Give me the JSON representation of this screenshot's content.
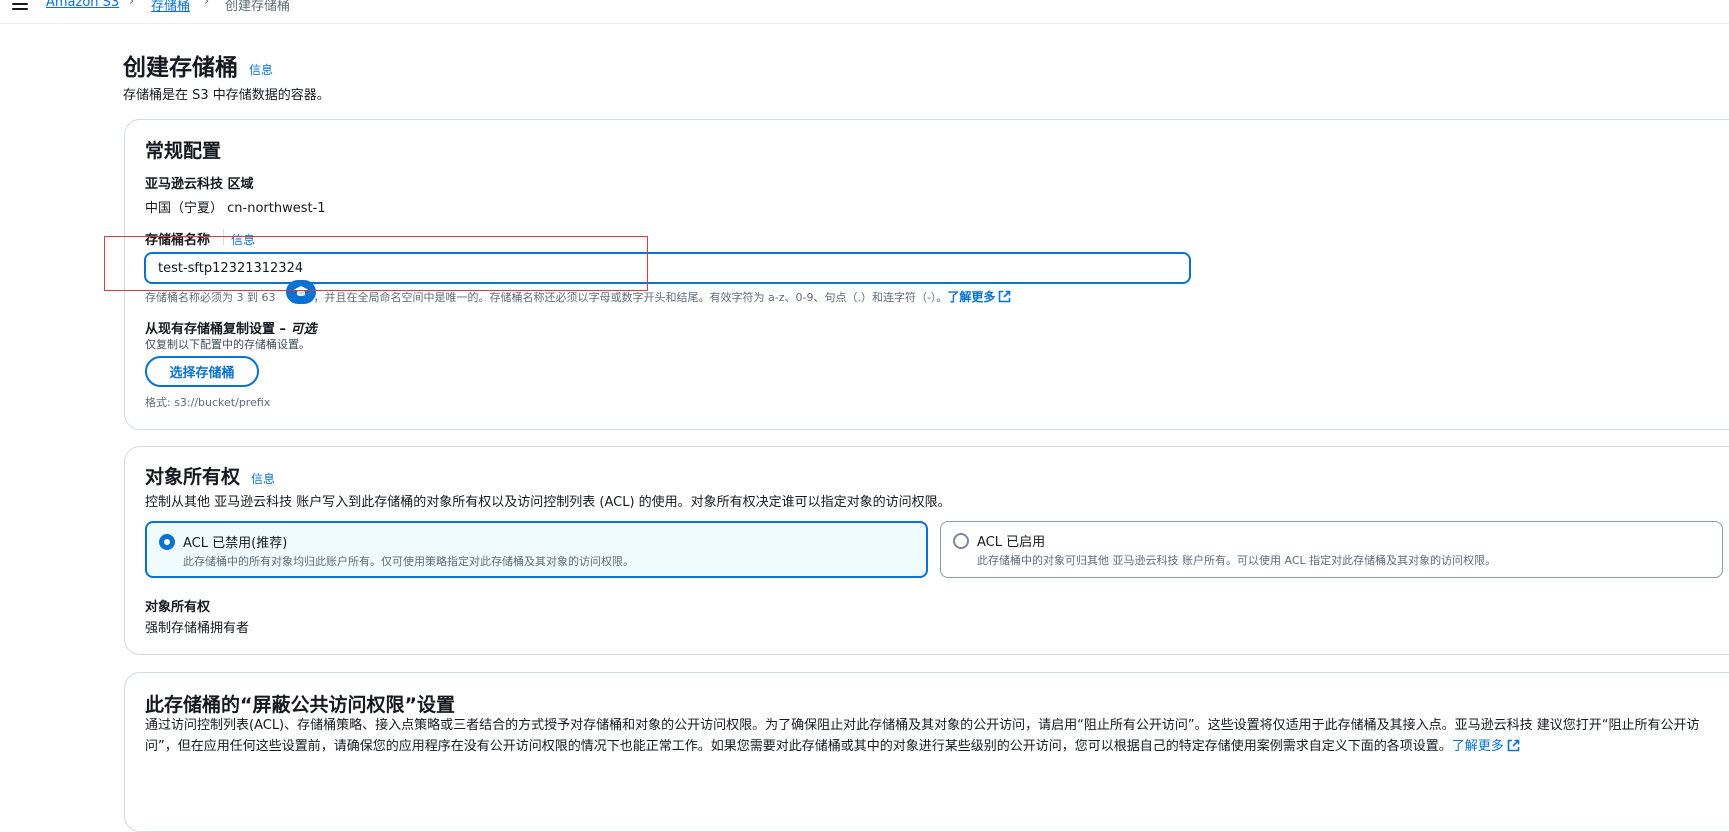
{
  "breadcrumb": {
    "service": "Amazon S3",
    "buckets": "存储桶",
    "current": "创建存储桶"
  },
  "page": {
    "title": "创建存储桶",
    "info": "信息",
    "description": "存储桶是在 S3 中存储数据的容器。"
  },
  "general": {
    "title": "常规配置",
    "region_label": "亚马逊云科技 区域",
    "region_value": "中国（宁夏） cn-northwest-1",
    "name_label": "存储桶名称",
    "name_info": "信息",
    "name_value": "test-sftp12321312324",
    "name_hint_a": "存储桶名称必须为 3 到 63",
    "name_hint_b": "符，并且在全局命名空间中是唯一的。存储桶名称还必须以字母或数字开头和结尾。有效字符为 a-z、0-9、句点（.）和连字符（-）。",
    "learn_more": "了解更多",
    "copy_label": "从现有存储桶复制设置 – ",
    "copy_optional": "可选",
    "copy_desc": "仅复制以下配置中的存储桶设置。",
    "choose_bucket": "选择存储桶",
    "format_hint": "格式: s3://bucket/prefix"
  },
  "ownership": {
    "title": "对象所有权",
    "info": "信息",
    "description": "控制从其他 亚马逊云科技 账户写入到此存储桶的对象所有权以及访问控制列表 (ACL) 的使用。对象所有权决定谁可以指定对象的访问权限。",
    "option1_title": "ACL 已禁用(推荐)",
    "option1_desc": "此存储桶中的所有对象均归此账户所有。仅可使用策略指定对此存储桶及其对象的访问权限。",
    "option2_title": "ACL 已启用",
    "option2_desc": "此存储桶中的对象可归其他 亚马逊云科技 账户所有。可以使用 ACL 指定对此存储桶及其对象的访问权限。",
    "selected": "ACL 已禁用(推荐)",
    "owner_label": "对象所有权",
    "owner_value": "强制存储桶拥有者"
  },
  "block_public": {
    "title": "此存储桶的“屏蔽公共访问权限”设置",
    "description": "通过访问控制列表(ACL)、存储桶策略、接入点策略或三者结合的方式授予对存储桶和对象的公开访问权限。为了确保阻止对此存储桶及其对象的公开访问，请启用“阻止所有公开访问”。这些设置将仅适用于此存储桶及其接入点。亚马逊云科技 建议您打开“阻止所有公开访问”，但在应用任何这些设置前，请确保您的应用程序在没有公开访问权限的情况下也能正常工作。如果您需要对此存储桶或其中的对象进行某些级别的公开访问，您可以根据自己的特定存储使用案例需求自定义下面的各项设置。",
    "learn_more": "了解更多"
  },
  "colors": {
    "accent": "#0972d3",
    "annotation": "#e0393e",
    "selected_bg": "#f0fbff"
  },
  "icons": {
    "menu": "hamburger-menu-icon",
    "separator": "chevron-right-icon",
    "external": "external-link-icon",
    "float": "graduation-cap-icon"
  }
}
